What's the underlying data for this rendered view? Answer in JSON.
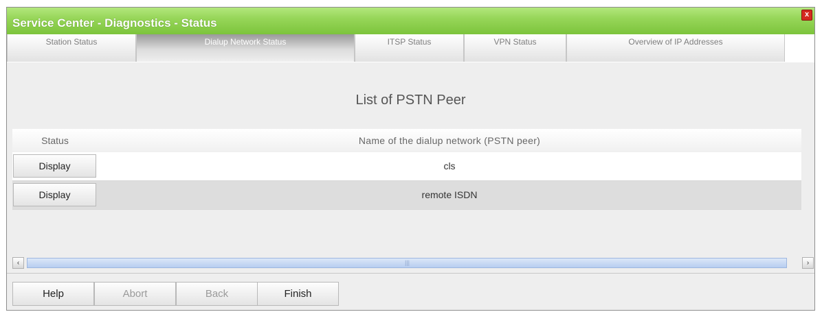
{
  "window": {
    "title": "Service Center - Diagnostics - Status",
    "close_label": "x"
  },
  "tabs": [
    {
      "label": "Station Status",
      "active": false
    },
    {
      "label": "Dialup Network Status",
      "active": true
    },
    {
      "label": "ITSP Status",
      "active": false
    },
    {
      "label": "VPN Status",
      "active": false
    },
    {
      "label": "Overview of IP Addresses",
      "active": false
    }
  ],
  "main": {
    "heading": "List of PSTN Peer",
    "table": {
      "headers": [
        "Status",
        "Name of the dialup network (PSTN peer)"
      ],
      "rows": [
        {
          "button": "Display",
          "name": "cls"
        },
        {
          "button": "Display",
          "name": "remote ISDN"
        }
      ]
    }
  },
  "scrollbar": {
    "left_arrow": "‹",
    "right_arrow": "›",
    "grip": "|||"
  },
  "footer": {
    "help": "Help",
    "abort": "Abort",
    "back": "Back",
    "finish": "Finish"
  },
  "colors": {
    "titlebar": "#97d659",
    "close_button": "#d42a20",
    "scroll_thumb": "#c9daf4"
  }
}
